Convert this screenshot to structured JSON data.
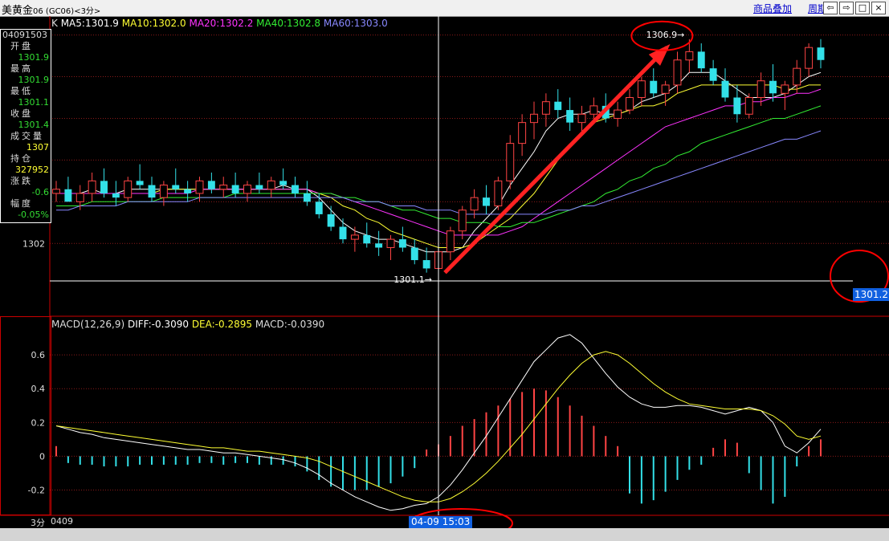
{
  "window": {
    "title": "美黄金",
    "code": "06 (GC06)",
    "period": "<3分>",
    "menu_overlay": "商品叠加",
    "menu_cycle": "周期"
  },
  "info": {
    "date": "04091503",
    "items": [
      {
        "label": "开盘",
        "value": "1301.9",
        "color": "#33dd33"
      },
      {
        "label": "最高",
        "value": "1301.9",
        "color": "#33dd33"
      },
      {
        "label": "最低",
        "value": "1301.1",
        "color": "#33dd33"
      },
      {
        "label": "收盘",
        "value": "1301.4",
        "color": "#33dd33"
      },
      {
        "label": "成交量",
        "value": "1307",
        "color": "#ffff33"
      },
      {
        "label": "持仓",
        "value": "327952",
        "color": "#ffff33"
      },
      {
        "label": "涨跌",
        "value": "-0.6",
        "color": "#33dd33"
      },
      {
        "label": "幅度",
        "value": "-0.05%",
        "color": "#33dd33"
      }
    ]
  },
  "legend_k": {
    "k": "K",
    "ma5": "MA5:1301.9",
    "ma10": "MA10:1302.0",
    "ma20": "MA20:1302.2",
    "ma40": "MA40:1302.8",
    "ma60": "MA60:1303.0"
  },
  "legend_macd": {
    "name": "MACD(12,26,9)",
    "diff": "DIFF:-0.3090",
    "dea": "DEA:-0.2895",
    "macd": "MACD:-0.0390"
  },
  "annotations": {
    "high": "1306.9",
    "low": "1301.1",
    "price_tag": "1301.2",
    "time_tag": "04-09 15:03"
  },
  "bottom": {
    "period_label": "3分",
    "date_start": "0409"
  },
  "colors": {
    "up": "#ff4444",
    "down": "#33e0e8",
    "ma5": "#ffffff",
    "ma10": "#ffff33",
    "ma20": "#ff33ff",
    "ma40": "#33ee33",
    "ma60": "#8888ff",
    "arrow": "#ff2222",
    "circle": "#ff0000"
  },
  "chart_data": [
    {
      "type": "candlestick",
      "title": "",
      "y_ticks": [
        "1302"
      ],
      "ylim": [
        1300.6,
        1307.3
      ],
      "grid": true,
      "ohlc": [
        [
          1303.2,
          1303.5,
          1303.0,
          1303.3
        ],
        [
          1303.3,
          1303.6,
          1303.1,
          1303.0
        ],
        [
          1303.0,
          1303.4,
          1302.8,
          1303.2
        ],
        [
          1303.2,
          1303.7,
          1303.0,
          1303.5
        ],
        [
          1303.5,
          1303.8,
          1303.1,
          1303.2
        ],
        [
          1303.2,
          1303.5,
          1302.9,
          1303.1
        ],
        [
          1303.1,
          1303.6,
          1303.0,
          1303.5
        ],
        [
          1303.5,
          1303.9,
          1303.3,
          1303.4
        ],
        [
          1303.4,
          1303.6,
          1303.0,
          1303.1
        ],
        [
          1303.1,
          1303.5,
          1302.9,
          1303.4
        ],
        [
          1303.4,
          1303.8,
          1303.2,
          1303.3
        ],
        [
          1303.3,
          1303.5,
          1303.0,
          1303.2
        ],
        [
          1303.2,
          1303.6,
          1303.0,
          1303.5
        ],
        [
          1303.5,
          1303.7,
          1303.2,
          1303.3
        ],
        [
          1303.3,
          1303.6,
          1303.1,
          1303.4
        ],
        [
          1303.4,
          1303.7,
          1303.1,
          1303.2
        ],
        [
          1303.2,
          1303.5,
          1303.0,
          1303.4
        ],
        [
          1303.4,
          1303.7,
          1303.2,
          1303.3
        ],
        [
          1303.3,
          1303.6,
          1303.1,
          1303.5
        ],
        [
          1303.5,
          1303.8,
          1303.3,
          1303.4
        ],
        [
          1303.4,
          1303.6,
          1303.1,
          1303.2
        ],
        [
          1303.2,
          1303.5,
          1302.9,
          1303.0
        ],
        [
          1303.0,
          1303.2,
          1302.6,
          1302.7
        ],
        [
          1302.7,
          1302.9,
          1302.3,
          1302.4
        ],
        [
          1302.4,
          1302.6,
          1302.0,
          1302.1
        ],
        [
          1302.1,
          1302.4,
          1301.8,
          1302.2
        ],
        [
          1302.2,
          1302.5,
          1301.9,
          1302.0
        ],
        [
          1302.0,
          1302.3,
          1301.7,
          1301.9
        ],
        [
          1301.9,
          1302.2,
          1301.6,
          1302.1
        ],
        [
          1302.1,
          1302.4,
          1301.8,
          1301.9
        ],
        [
          1301.9,
          1302.1,
          1301.5,
          1301.6
        ],
        [
          1301.6,
          1301.9,
          1301.3,
          1301.4
        ],
        [
          1301.4,
          1301.9,
          1301.1,
          1301.8
        ],
        [
          1301.8,
          1302.4,
          1301.6,
          1302.3
        ],
        [
          1302.3,
          1302.9,
          1302.1,
          1302.8
        ],
        [
          1302.8,
          1303.3,
          1302.6,
          1303.1
        ],
        [
          1303.1,
          1303.4,
          1302.7,
          1302.9
        ],
        [
          1302.9,
          1303.6,
          1302.8,
          1303.5
        ],
        [
          1303.5,
          1304.6,
          1303.3,
          1304.4
        ],
        [
          1304.4,
          1305.1,
          1304.1,
          1304.9
        ],
        [
          1304.9,
          1305.4,
          1304.5,
          1305.1
        ],
        [
          1305.1,
          1305.6,
          1304.8,
          1305.4
        ],
        [
          1305.4,
          1305.7,
          1305.0,
          1305.2
        ],
        [
          1305.2,
          1305.5,
          1304.7,
          1304.9
        ],
        [
          1304.9,
          1305.3,
          1304.6,
          1305.1
        ],
        [
          1305.1,
          1305.5,
          1304.9,
          1305.3
        ],
        [
          1305.3,
          1305.6,
          1304.9,
          1305.0
        ],
        [
          1305.0,
          1305.4,
          1304.8,
          1305.2
        ],
        [
          1305.2,
          1305.7,
          1305.1,
          1305.5
        ],
        [
          1305.5,
          1306.0,
          1305.3,
          1305.9
        ],
        [
          1305.9,
          1306.2,
          1305.5,
          1305.6
        ],
        [
          1305.6,
          1305.9,
          1305.3,
          1305.8
        ],
        [
          1305.8,
          1306.6,
          1305.6,
          1306.4
        ],
        [
          1306.4,
          1306.9,
          1306.1,
          1306.6
        ],
        [
          1306.6,
          1306.8,
          1306.1,
          1306.2
        ],
        [
          1306.2,
          1306.4,
          1305.8,
          1305.9
        ],
        [
          1305.9,
          1306.2,
          1305.4,
          1305.5
        ],
        [
          1305.5,
          1305.8,
          1304.9,
          1305.1
        ],
        [
          1305.1,
          1305.6,
          1305.0,
          1305.5
        ],
        [
          1305.5,
          1306.1,
          1305.3,
          1305.9
        ],
        [
          1305.9,
          1306.3,
          1305.4,
          1305.6
        ],
        [
          1305.6,
          1305.9,
          1305.2,
          1305.8
        ],
        [
          1305.8,
          1306.4,
          1305.6,
          1306.2
        ],
        [
          1306.2,
          1306.8,
          1306.0,
          1306.7
        ],
        [
          1306.7,
          1306.9,
          1306.2,
          1306.4
        ]
      ],
      "series": [
        {
          "name": "MA5",
          "values": [
            1303.2,
            1303.2,
            1303.2,
            1303.3,
            1303.2,
            1303.2,
            1303.3,
            1303.3,
            1303.3,
            1303.3,
            1303.3,
            1303.3,
            1303.3,
            1303.3,
            1303.3,
            1303.3,
            1303.3,
            1303.3,
            1303.3,
            1303.4,
            1303.3,
            1303.3,
            1303.1,
            1302.8,
            1302.5,
            1302.3,
            1302.2,
            1302.1,
            1302.1,
            1302.0,
            1301.9,
            1301.8,
            1301.8,
            1301.8,
            1301.9,
            1302.3,
            1302.6,
            1302.9,
            1303.4,
            1303.8,
            1304.2,
            1304.7,
            1305.0,
            1305.1,
            1305.1,
            1305.2,
            1305.1,
            1305.1,
            1305.2,
            1305.4,
            1305.5,
            1305.6,
            1305.8,
            1306.1,
            1306.1,
            1306.1,
            1305.9,
            1305.7,
            1305.5,
            1305.5,
            1305.5,
            1305.6,
            1305.8,
            1306.0,
            1306.1
          ]
        },
        {
          "name": "MA10",
          "values": [
            1303.2,
            1303.2,
            1303.2,
            1303.2,
            1303.2,
            1303.2,
            1303.2,
            1303.2,
            1303.2,
            1303.3,
            1303.3,
            1303.3,
            1303.3,
            1303.3,
            1303.3,
            1303.3,
            1303.3,
            1303.3,
            1303.3,
            1303.3,
            1303.3,
            1303.3,
            1303.2,
            1303.1,
            1302.9,
            1302.8,
            1302.6,
            1302.5,
            1302.3,
            1302.2,
            1302.1,
            1302.0,
            1301.9,
            1301.9,
            1301.9,
            1302.0,
            1302.2,
            1302.4,
            1302.6,
            1302.9,
            1303.2,
            1303.6,
            1304.0,
            1304.3,
            1304.6,
            1304.9,
            1305.0,
            1305.1,
            1305.2,
            1305.3,
            1305.3,
            1305.4,
            1305.6,
            1305.7,
            1305.8,
            1305.8,
            1305.8,
            1305.8,
            1305.8,
            1305.8,
            1305.8,
            1305.7,
            1305.7,
            1305.8,
            1305.8
          ]
        },
        {
          "name": "MA20",
          "values": [
            1303.2,
            1303.2,
            1303.2,
            1303.2,
            1303.2,
            1303.2,
            1303.2,
            1303.2,
            1303.2,
            1303.2,
            1303.2,
            1303.2,
            1303.3,
            1303.3,
            1303.3,
            1303.3,
            1303.3,
            1303.3,
            1303.3,
            1303.3,
            1303.3,
            1303.3,
            1303.2,
            1303.2,
            1303.1,
            1303.0,
            1302.9,
            1302.8,
            1302.7,
            1302.6,
            1302.5,
            1302.4,
            1302.3,
            1302.2,
            1302.2,
            1302.2,
            1302.2,
            1302.2,
            1302.3,
            1302.4,
            1302.6,
            1302.8,
            1303.0,
            1303.2,
            1303.4,
            1303.6,
            1303.8,
            1304.0,
            1304.2,
            1304.4,
            1304.6,
            1304.8,
            1304.9,
            1305.0,
            1305.1,
            1305.2,
            1305.3,
            1305.3,
            1305.4,
            1305.4,
            1305.5,
            1305.5,
            1305.6,
            1305.6,
            1305.7
          ]
        },
        {
          "name": "MA40",
          "values": [
            1302.9,
            1302.9,
            1302.9,
            1303.0,
            1303.0,
            1303.0,
            1303.0,
            1303.0,
            1303.0,
            1303.1,
            1303.1,
            1303.1,
            1303.1,
            1303.1,
            1303.1,
            1303.2,
            1303.2,
            1303.2,
            1303.2,
            1303.2,
            1303.2,
            1303.2,
            1303.2,
            1303.2,
            1303.1,
            1303.1,
            1303.0,
            1303.0,
            1302.9,
            1302.8,
            1302.8,
            1302.7,
            1302.6,
            1302.6,
            1302.5,
            1302.5,
            1302.5,
            1302.4,
            1302.4,
            1302.5,
            1302.5,
            1302.6,
            1302.7,
            1302.8,
            1302.9,
            1303.0,
            1303.2,
            1303.3,
            1303.5,
            1303.6,
            1303.8,
            1303.9,
            1304.1,
            1304.2,
            1304.4,
            1304.5,
            1304.6,
            1304.7,
            1304.8,
            1304.9,
            1305.0,
            1305.0,
            1305.1,
            1305.2,
            1305.3
          ]
        },
        {
          "name": "MA60",
          "values": [
            1302.8,
            1302.8,
            1302.9,
            1302.9,
            1302.9,
            1302.9,
            1303.0,
            1303.0,
            1303.0,
            1303.0,
            1303.0,
            1303.0,
            1303.1,
            1303.1,
            1303.1,
            1303.1,
            1303.1,
            1303.1,
            1303.1,
            1303.1,
            1303.1,
            1303.1,
            1303.1,
            1303.1,
            1303.1,
            1303.0,
            1303.0,
            1303.0,
            1302.9,
            1302.9,
            1302.9,
            1302.8,
            1302.8,
            1302.8,
            1302.7,
            1302.7,
            1302.7,
            1302.7,
            1302.7,
            1302.7,
            1302.7,
            1302.7,
            1302.8,
            1302.8,
            1302.9,
            1302.9,
            1303.0,
            1303.1,
            1303.2,
            1303.3,
            1303.4,
            1303.5,
            1303.6,
            1303.7,
            1303.8,
            1303.9,
            1304.0,
            1304.1,
            1304.2,
            1304.3,
            1304.4,
            1304.5,
            1304.5,
            1304.6,
            1304.7
          ]
        }
      ]
    },
    {
      "type": "macd",
      "title": "",
      "y_ticks": [
        "0.6",
        "0.4",
        "0.2",
        "0",
        "-0.2"
      ],
      "ylim": [
        -0.34,
        0.8
      ],
      "grid": true,
      "series": [
        {
          "name": "DIFF",
          "values": [
            0.18,
            0.16,
            0.14,
            0.13,
            0.11,
            0.1,
            0.09,
            0.08,
            0.07,
            0.06,
            0.05,
            0.04,
            0.04,
            0.03,
            0.02,
            0.02,
            0.01,
            0.0,
            -0.01,
            -0.02,
            -0.04,
            -0.07,
            -0.11,
            -0.16,
            -0.2,
            -0.24,
            -0.27,
            -0.3,
            -0.32,
            -0.31,
            -0.29,
            -0.28,
            -0.24,
            -0.17,
            -0.08,
            0.02,
            0.12,
            0.23,
            0.34,
            0.45,
            0.56,
            0.63,
            0.7,
            0.72,
            0.67,
            0.58,
            0.49,
            0.41,
            0.35,
            0.31,
            0.29,
            0.29,
            0.3,
            0.3,
            0.29,
            0.27,
            0.25,
            0.27,
            0.29,
            0.27,
            0.2,
            0.06,
            0.02,
            0.08,
            0.16
          ]
        },
        {
          "name": "DEA",
          "values": [
            0.18,
            0.17,
            0.16,
            0.15,
            0.14,
            0.13,
            0.12,
            0.11,
            0.1,
            0.09,
            0.08,
            0.07,
            0.06,
            0.05,
            0.05,
            0.04,
            0.03,
            0.03,
            0.02,
            0.01,
            0.0,
            -0.01,
            -0.03,
            -0.06,
            -0.09,
            -0.12,
            -0.15,
            -0.18,
            -0.21,
            -0.24,
            -0.26,
            -0.27,
            -0.27,
            -0.25,
            -0.21,
            -0.16,
            -0.1,
            -0.03,
            0.05,
            0.13,
            0.22,
            0.31,
            0.4,
            0.48,
            0.55,
            0.6,
            0.62,
            0.6,
            0.55,
            0.49,
            0.43,
            0.38,
            0.34,
            0.31,
            0.3,
            0.29,
            0.28,
            0.28,
            0.28,
            0.27,
            0.24,
            0.19,
            0.12,
            0.1,
            0.12
          ]
        }
      ],
      "macd_bars": [
        0.06,
        -0.04,
        -0.05,
        -0.05,
        -0.06,
        -0.06,
        -0.06,
        -0.05,
        -0.05,
        -0.05,
        -0.05,
        -0.05,
        -0.04,
        -0.04,
        -0.05,
        -0.04,
        -0.04,
        -0.05,
        -0.05,
        -0.05,
        -0.06,
        -0.09,
        -0.14,
        -0.18,
        -0.2,
        -0.2,
        -0.2,
        -0.18,
        -0.16,
        -0.12,
        -0.07,
        0.04,
        0.07,
        0.12,
        0.18,
        0.22,
        0.26,
        0.3,
        0.34,
        0.38,
        0.4,
        0.39,
        0.35,
        0.3,
        0.24,
        0.18,
        0.12,
        0.06,
        -0.22,
        -0.28,
        -0.26,
        -0.21,
        -0.14,
        -0.08,
        -0.05,
        0.05,
        0.1,
        0.08,
        -0.1,
        -0.2,
        -0.28,
        -0.24,
        -0.06,
        0.06,
        0.1
      ]
    }
  ]
}
